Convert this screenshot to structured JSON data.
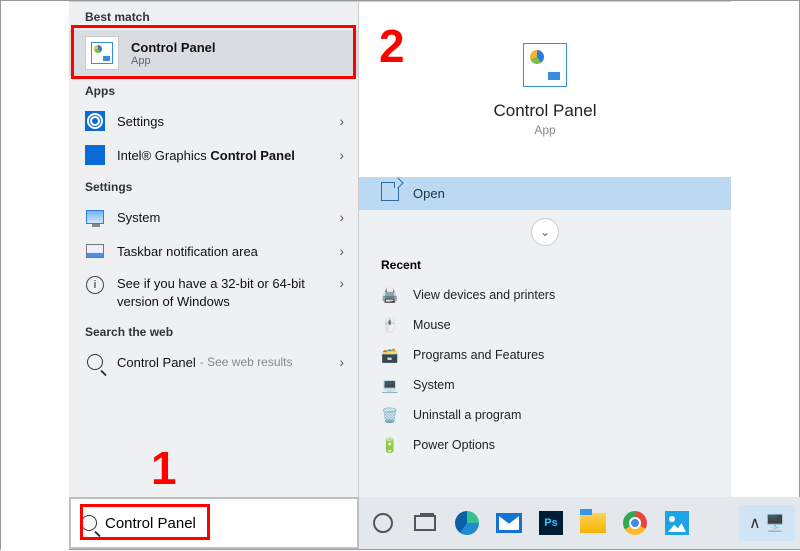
{
  "left": {
    "best_match_h": "Best match",
    "best": {
      "title": "Control Panel",
      "sub": "App"
    },
    "apps_h": "Apps",
    "apps": [
      {
        "label": "Settings"
      },
      {
        "label_pre": "Intel® Graphics ",
        "label_bold": "Control Panel"
      }
    ],
    "settings_h": "Settings",
    "settings": [
      {
        "label": "System"
      },
      {
        "label": "Taskbar notification area"
      },
      {
        "label": "See if you have a 32-bit or 64-bit version of Windows"
      }
    ],
    "web_h": "Search the web",
    "web": {
      "label": "Control Panel",
      "suffix": "- See web results"
    }
  },
  "right": {
    "title": "Control Panel",
    "sub": "App",
    "open": "Open",
    "recent_h": "Recent",
    "recent": [
      "View devices and printers",
      "Mouse",
      "Programs and Features",
      "System",
      "Uninstall a program",
      "Power Options"
    ]
  },
  "search": {
    "value": "Control Panel"
  },
  "annot": {
    "one": "1",
    "two": "2"
  }
}
